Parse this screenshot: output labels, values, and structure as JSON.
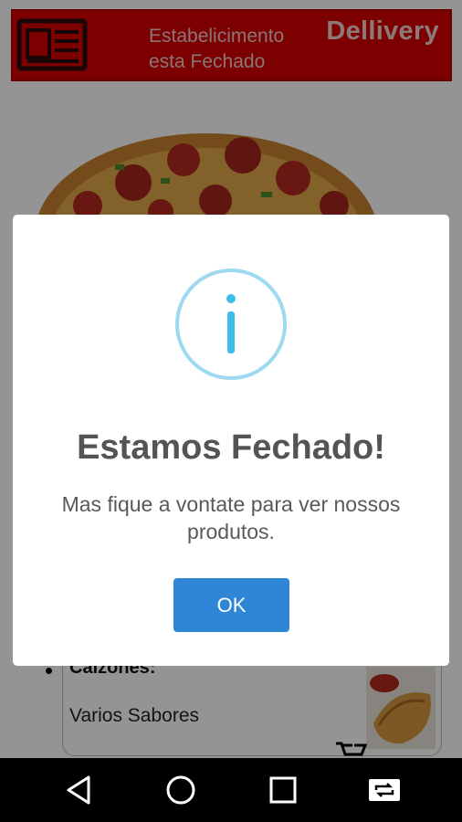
{
  "header": {
    "status_line1": "Estabelicimento",
    "status_line2": "esta Fechado",
    "brand": "Dellivery",
    "icon": "newspaper-icon",
    "color": "#d60000"
  },
  "menu": {
    "items": [
      {
        "name": "Calzones",
        "suffix": ":",
        "description": "Varios Sabores"
      }
    ]
  },
  "dialog": {
    "icon": "info-icon",
    "title": "Estamos Fechado!",
    "message": "Mas fique a vontate para ver nossos produtos.",
    "ok_label": "OK",
    "accent": "#2f86d6",
    "icon_color": "#8fd2ee"
  },
  "navbar": {
    "buttons": [
      "back-icon",
      "home-icon",
      "recents-icon",
      "rotate-icon"
    ]
  }
}
